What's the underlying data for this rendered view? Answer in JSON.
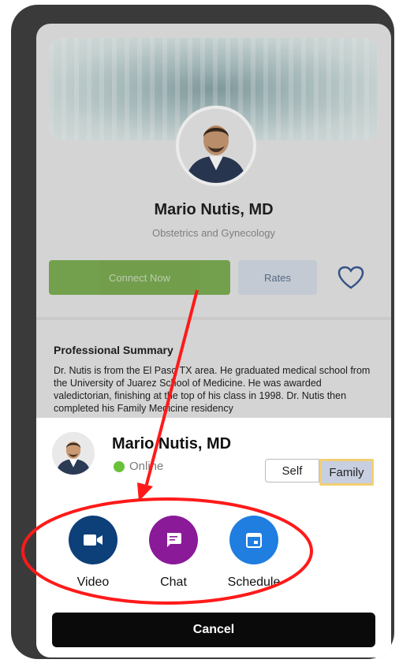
{
  "profile": {
    "name": "Mario Nutis, MD",
    "specialty": "Obstetrics and Gynecology",
    "connect_label": "Connect Now",
    "rates_label": "Rates",
    "summary_title": "Professional Summary",
    "summary_text": "Dr. Nutis is from the El Paso TX area. He graduated medical school from the University of Juarez School of Medicine. He was awarded valedictorian, finishing at the top of his class in 1998. Dr. Nutis then completed his Family Medicine residency"
  },
  "sheet": {
    "name": "Mario Nutis, MD",
    "status": "Online",
    "toggle": {
      "self": "Self",
      "family": "Family",
      "selected": "Family"
    },
    "actions": [
      {
        "label": "Video",
        "icon": "video-camera-icon",
        "color": "#0d3f78"
      },
      {
        "label": "Chat",
        "icon": "chat-bubble-icon",
        "color": "#8a1a98"
      },
      {
        "label": "Schedule",
        "icon": "calendar-icon",
        "color": "#1f7ee0"
      }
    ],
    "cancel_label": "Cancel"
  },
  "colors": {
    "accent_green": "#6aa33a",
    "online_green": "#68c23a",
    "annotation_red": "#ff1a1a",
    "highlight_yellow": "#f2cf74"
  }
}
